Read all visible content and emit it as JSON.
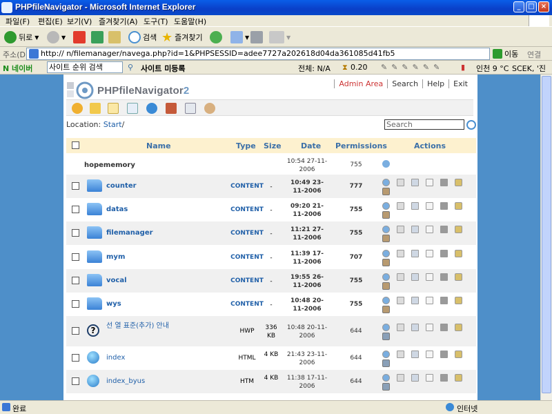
{
  "window": {
    "title": "PHPfileNavigator - Microsoft Internet Explorer"
  },
  "menu": [
    "파일(F)",
    "편집(E)",
    "보기(V)",
    "즐겨찾기(A)",
    "도구(T)",
    "도움말(H)"
  ],
  "toolbar": {
    "back_label": "뒤로",
    "search_label": "검색",
    "favorites_label": "즐겨찾기"
  },
  "address": {
    "label": "주소(D)",
    "url": "http://                       n/filemanager/navega.php?id=1&PHPSESSID=adee7727a202618d04da361085d41fb5",
    "go_label": "이동",
    "links_label": "연결"
  },
  "naver": {
    "logo": "N 네이버",
    "search_placeholder": "사이트 순위 검색",
    "site_register": "사이트 미등록",
    "total": "전체: N/A",
    "rank_value": "0.20",
    "weather": "인천 9 °C",
    "extra": "SCEK, '진"
  },
  "app": {
    "brand_name": "PHPfileNavigator",
    "brand_version": "2",
    "links": [
      "Admin Area",
      "Search",
      "Help",
      "Exit"
    ],
    "location_label": "Location:",
    "location_start": "Start",
    "location_sep": "/",
    "search_placeholder": "Search"
  },
  "table": {
    "headers": {
      "name": "Name",
      "type": "Type",
      "size": "Size",
      "date": "Date",
      "permissions": "Permissions",
      "actions": "Actions"
    },
    "parent": {
      "name": "hopememory",
      "date": "10:54 27-11-2006",
      "perm": "755"
    },
    "rows": [
      {
        "name": "counter",
        "type": "CONTENT",
        "size": "-",
        "date": "10:49 23-11-2006",
        "perm": "777",
        "kind": "folder"
      },
      {
        "name": "datas",
        "type": "CONTENT",
        "size": "-",
        "date": "09:20 21-11-2006",
        "perm": "755",
        "kind": "folder"
      },
      {
        "name": "filemanager",
        "type": "CONTENT",
        "size": "-",
        "date": "11:21 27-11-2006",
        "perm": "755",
        "kind": "folder"
      },
      {
        "name": "mym",
        "type": "CONTENT",
        "size": "-",
        "date": "11:39 17-11-2006",
        "perm": "707",
        "kind": "folder"
      },
      {
        "name": "vocal",
        "type": "CONTENT",
        "size": "-",
        "date": "19:55 26-11-2006",
        "perm": "755",
        "kind": "folder"
      },
      {
        "name": "wys",
        "type": "CONTENT",
        "size": "-",
        "date": "10:48 20-11-2006",
        "perm": "755",
        "kind": "folder"
      },
      {
        "name": "선           열       표준(추가) 안내",
        "type": "HWP",
        "size": "336 KB",
        "date": "10:48 20-11-2006",
        "perm": "644",
        "kind": "unknown"
      },
      {
        "name": "index",
        "type": "HTML",
        "size": "4 KB",
        "date": "21:43 23-11-2006",
        "perm": "644",
        "kind": "web"
      },
      {
        "name": "index_byus",
        "type": "HTM",
        "size": "4 KB",
        "date": "11:38 17-11-2006",
        "perm": "644",
        "kind": "web"
      }
    ]
  },
  "status": {
    "text": "완료",
    "zone": "인터넷"
  },
  "colors": {
    "accent": "#1f5fa8",
    "header_bg": "#fdf1cf",
    "admin": "#cc3333",
    "page_bg": "#4e8fc9"
  }
}
